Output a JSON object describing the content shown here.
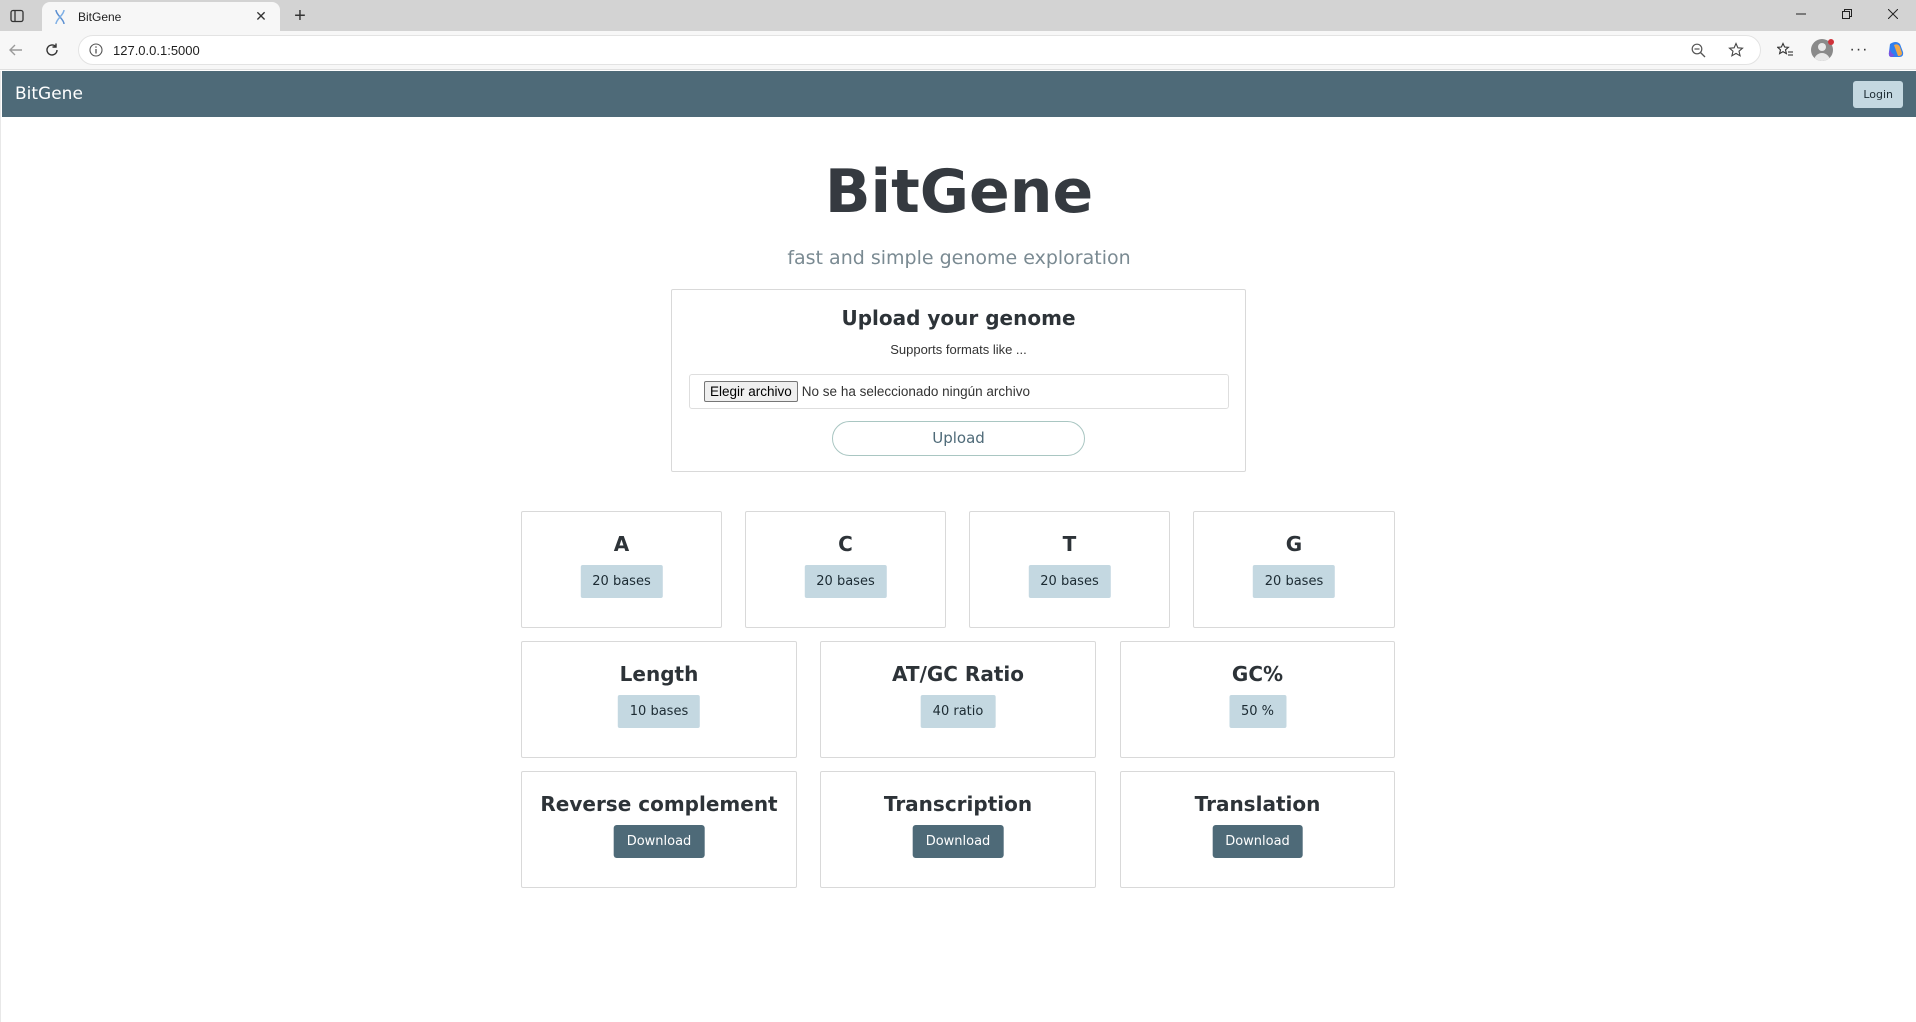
{
  "browser": {
    "tab_title": "BitGene",
    "url": "127.0.0.1:5000"
  },
  "navbar": {
    "brand": "BitGene",
    "login_label": "Login"
  },
  "hero": {
    "title": "BitGene",
    "subtitle": "fast and simple genome exploration"
  },
  "upload": {
    "title": "Upload your genome",
    "hint": "Supports formats like ...",
    "choose_file_label": "Elegir archivo",
    "file_status": "No se ha seleccionado ningún archivo",
    "upload_label": "Upload"
  },
  "bases": [
    {
      "title": "A",
      "value": "20 bases"
    },
    {
      "title": "C",
      "value": "20 bases"
    },
    {
      "title": "T",
      "value": "20 bases"
    },
    {
      "title": "G",
      "value": "20 bases"
    }
  ],
  "stats": [
    {
      "title": "Length",
      "value": "10 bases"
    },
    {
      "title": "AT/GC Ratio",
      "value": "40 ratio"
    },
    {
      "title": "GC%",
      "value": "50 %"
    }
  ],
  "downloads": [
    {
      "title": "Reverse complement",
      "label": "Download"
    },
    {
      "title": "Transcription",
      "label": "Download"
    },
    {
      "title": "Translation",
      "label": "Download"
    }
  ],
  "colors": {
    "navbar": "#4e6a78",
    "pill": "#c4d8e1",
    "download_button": "#4e6a78"
  }
}
